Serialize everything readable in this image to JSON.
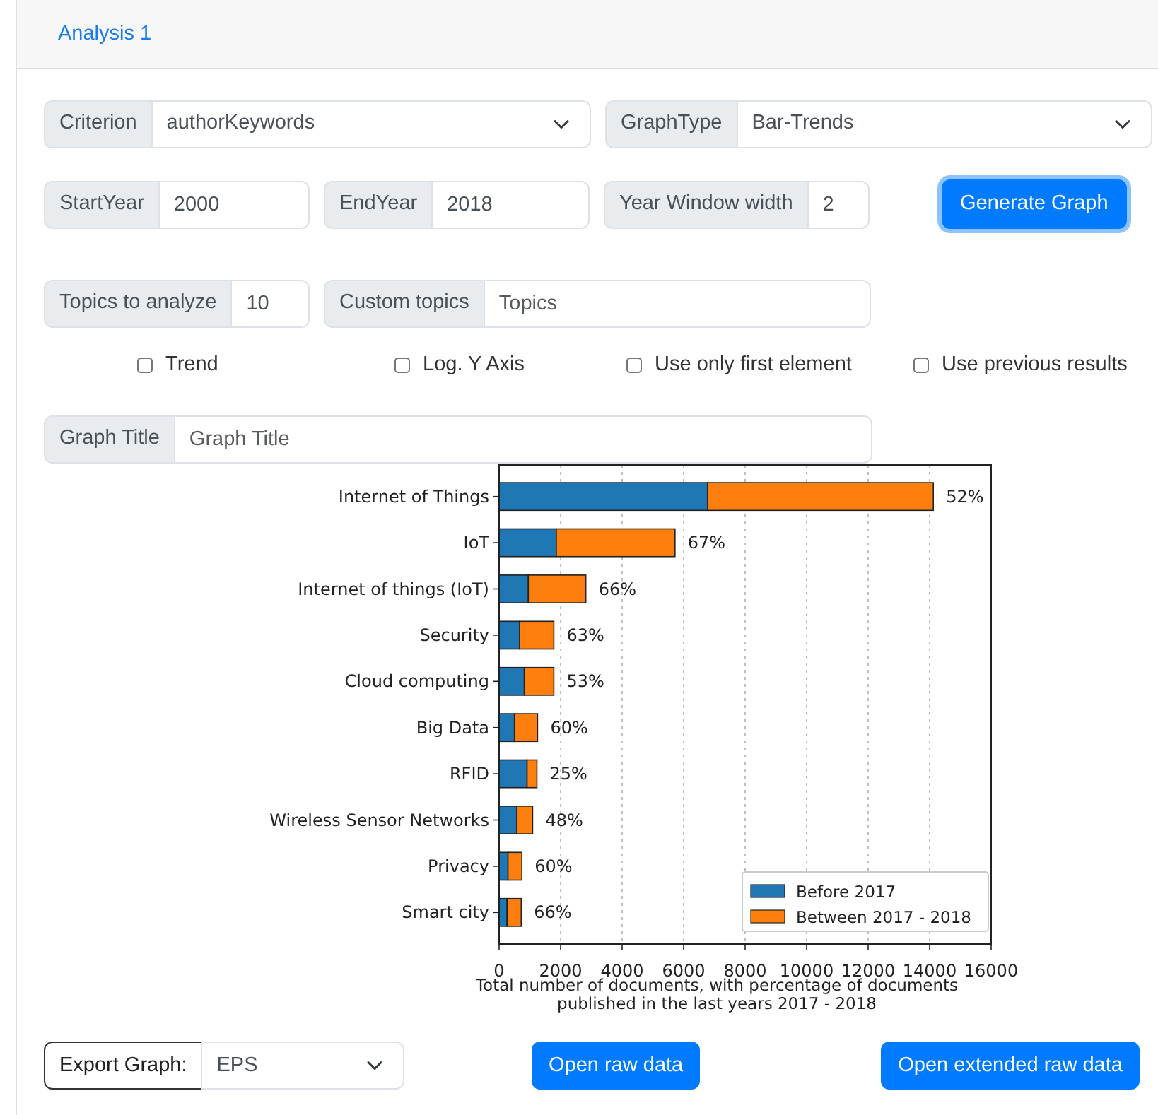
{
  "tab": {
    "label": "Analysis 1"
  },
  "selects": [
    {
      "label": "Criterion",
      "value": "authorKeywords"
    },
    {
      "label": "GraphType",
      "value": "Bar-Trends"
    }
  ],
  "year_fields": [
    {
      "label": "StartYear",
      "value": "2000"
    },
    {
      "label": "EndYear",
      "value": "2018"
    },
    {
      "label": "Year Window width",
      "value": "2"
    }
  ],
  "generate_button": {
    "label": "Generate Graph",
    "focused": true
  },
  "topic_fields": [
    {
      "label": "Topics to analyze",
      "value": "10"
    },
    {
      "label": "Custom topics",
      "placeholder": "Topics"
    }
  ],
  "options": [
    {
      "label": "Trend",
      "checked": false
    },
    {
      "label": "Log. Y Axis",
      "checked": false
    },
    {
      "label": "Use only first element",
      "checked": false
    },
    {
      "label": "Use previous results",
      "checked": false
    }
  ],
  "graph_title_field": {
    "label": "Graph Title",
    "placeholder": "Graph Title"
  },
  "chart": {
    "chart_data": {
      "type": "bar",
      "orientation": "horizontal",
      "stacked": true,
      "categories": [
        "Internet of Things",
        "IoT",
        "Internet of things (IoT)",
        "Security",
        "Cloud computing",
        "Big Data",
        "RFID",
        "Wireless Sensor Networks",
        "Privacy",
        "Smart city"
      ],
      "series": [
        {
          "name": "Before 2017",
          "color": "#1f77b4",
          "values": [
            6780,
            1860,
            950,
            670,
            820,
            500,
            910,
            580,
            290,
            260
          ]
        },
        {
          "name": "Between 2017 - 2018",
          "color": "#ff7f0e",
          "values": [
            7340,
            3860,
            1870,
            1110,
            960,
            750,
            320,
            510,
            450,
            460
          ]
        }
      ],
      "value_labels": [
        "52%",
        "67%",
        "66%",
        "63%",
        "53%",
        "60%",
        "25%",
        "48%",
        "60%",
        "66%"
      ],
      "xlabel": "Total number of documents, with percentage of documents published in the last years 2017 - 2018",
      "xlim": [
        0,
        16000
      ],
      "grid": true,
      "legend": "lower right",
      "xticks": [
        0,
        2000,
        4000,
        6000,
        8000,
        10000,
        12000,
        14000,
        16000
      ]
    }
  },
  "export": {
    "label": "Export Graph:",
    "value": "EPS"
  },
  "buttons": [
    "Open raw data",
    "Open extended raw data"
  ]
}
